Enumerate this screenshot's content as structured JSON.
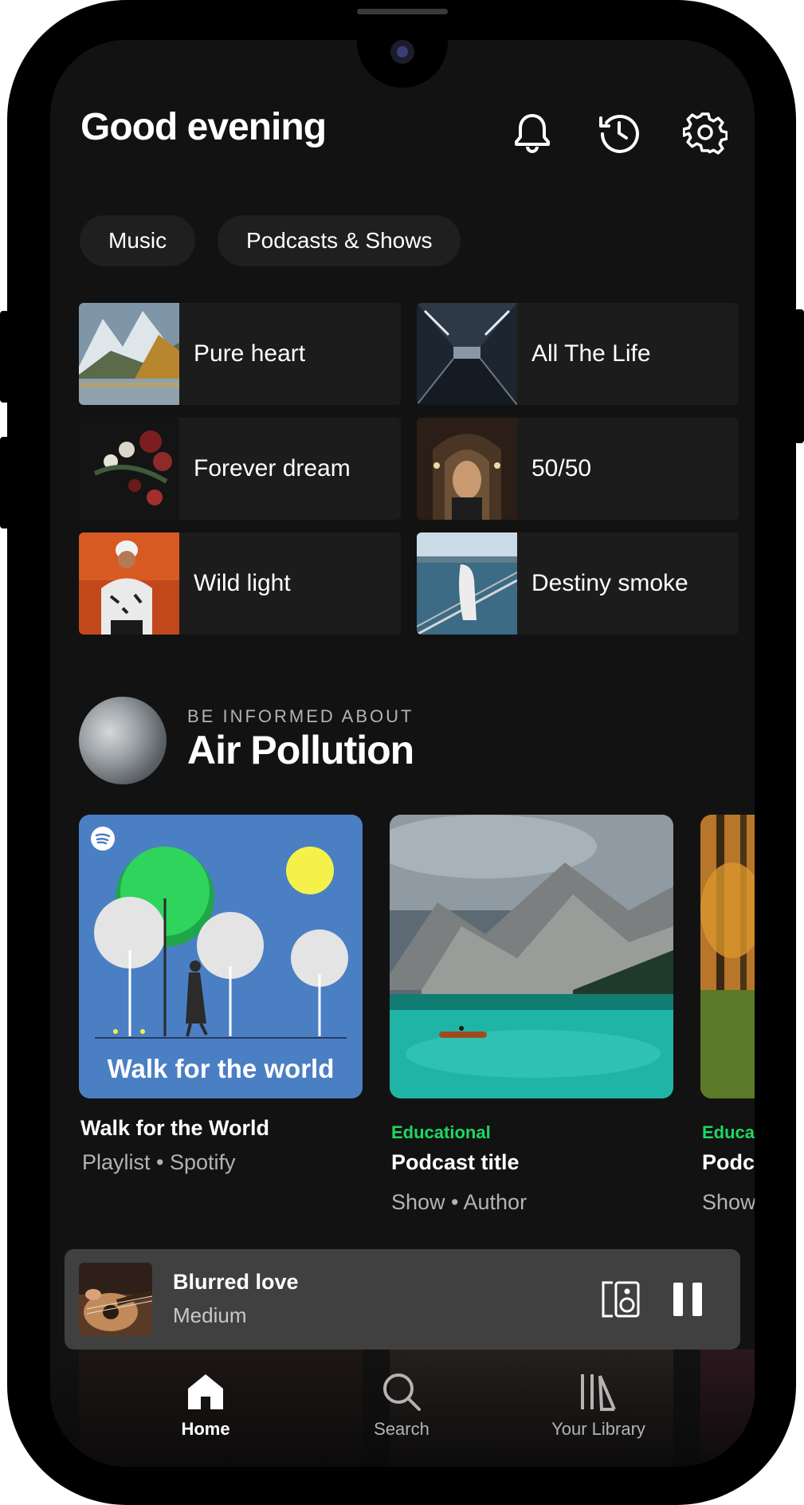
{
  "header": {
    "greeting": "Good evening",
    "icons": [
      "bell-icon",
      "history-icon",
      "gear-icon"
    ]
  },
  "filters": [
    "Music",
    "Podcasts & Shows"
  ],
  "shortcuts": [
    {
      "label": "Pure heart"
    },
    {
      "label": "All The Life"
    },
    {
      "label": "Forever dream"
    },
    {
      "label": "50/50"
    },
    {
      "label": "Wild light"
    },
    {
      "label": "Destiny smoke"
    }
  ],
  "section": {
    "kicker": "BE INFORMED ABOUT",
    "title": "Air Pollution"
  },
  "cards": [
    {
      "art_text": "Walk for the world",
      "title": "Walk for the World",
      "subtitle": "Playlist • Spotify"
    },
    {
      "tag": "Educational",
      "title": "Podcast title",
      "subtitle": "Show • Author"
    },
    {
      "tag": "Educa",
      "title": "Podc",
      "subtitle": "Show"
    }
  ],
  "player": {
    "title": "Blurred love",
    "subtitle": "Medium",
    "icons": [
      "speaker-device-icon",
      "pause-icon"
    ]
  },
  "nav": {
    "items": [
      {
        "label": "Home",
        "icon": "home-icon",
        "active": true
      },
      {
        "label": "Search",
        "icon": "search-icon",
        "active": false
      },
      {
        "label": "Your Library",
        "icon": "library-icon",
        "active": false
      }
    ]
  },
  "colors": {
    "background": "#121212",
    "accent_green": "#1ed760",
    "player_bg": "#404040",
    "chip_bg": "#1f1f1f"
  }
}
